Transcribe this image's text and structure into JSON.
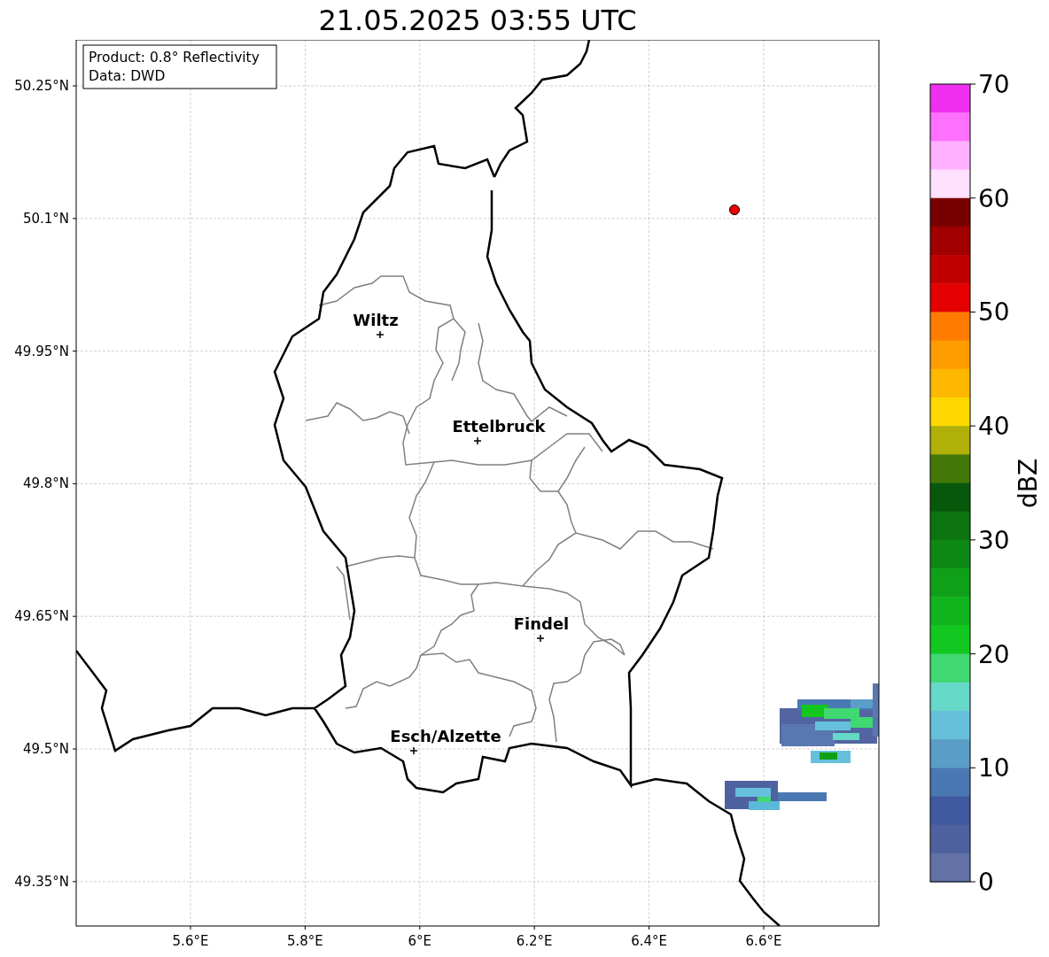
{
  "title": "21.05.2025 03:55 UTC",
  "info_box": {
    "lines": [
      "Product: 0.8° Reflectivity",
      "Data: DWD"
    ]
  },
  "map": {
    "lat_labels": [
      "50.25°N",
      "50.1°N",
      "49.95°N",
      "49.8°N",
      "49.65°N",
      "49.5°N",
      "49.35°N"
    ],
    "lon_labels": [
      "5.6°E",
      "5.8°E",
      "6°E",
      "6.2°E",
      "6.4°E",
      "6.6°E"
    ],
    "cities": [
      {
        "name": "Wiltz"
      },
      {
        "name": "Ettelbruck"
      },
      {
        "name": "Findel"
      },
      {
        "name": "Esch/Alzette"
      }
    ]
  },
  "colorbar": {
    "label": "dBZ",
    "ticks": [
      "70",
      "60",
      "50",
      "40",
      "30",
      "20",
      "10",
      "0"
    ],
    "bands": [
      {
        "color": "#f030f0"
      },
      {
        "color": "#ff70ff"
      },
      {
        "color": "#ffb0ff"
      },
      {
        "color": "#ffe0ff"
      },
      {
        "color": "#780000"
      },
      {
        "color": "#a00000"
      },
      {
        "color": "#c00000"
      },
      {
        "color": "#e40000"
      },
      {
        "color": "#ff7c00"
      },
      {
        "color": "#ff9c00"
      },
      {
        "color": "#ffb800"
      },
      {
        "color": "#ffd800"
      },
      {
        "color": "#b0b008"
      },
      {
        "color": "#447808"
      },
      {
        "color": "#08580c"
      },
      {
        "color": "#0c7410"
      },
      {
        "color": "#0e8814"
      },
      {
        "color": "#10a018"
      },
      {
        "color": "#10b41c"
      },
      {
        "color": "#12c820"
      },
      {
        "color": "#40d870"
      },
      {
        "color": "#66d8c8"
      },
      {
        "color": "#66c0dc"
      },
      {
        "color": "#5a9ec8"
      },
      {
        "color": "#4a78b2"
      },
      {
        "color": "#4159a0"
      },
      {
        "color": "#4f62a0"
      },
      {
        "color": "#6272a6"
      }
    ]
  }
}
